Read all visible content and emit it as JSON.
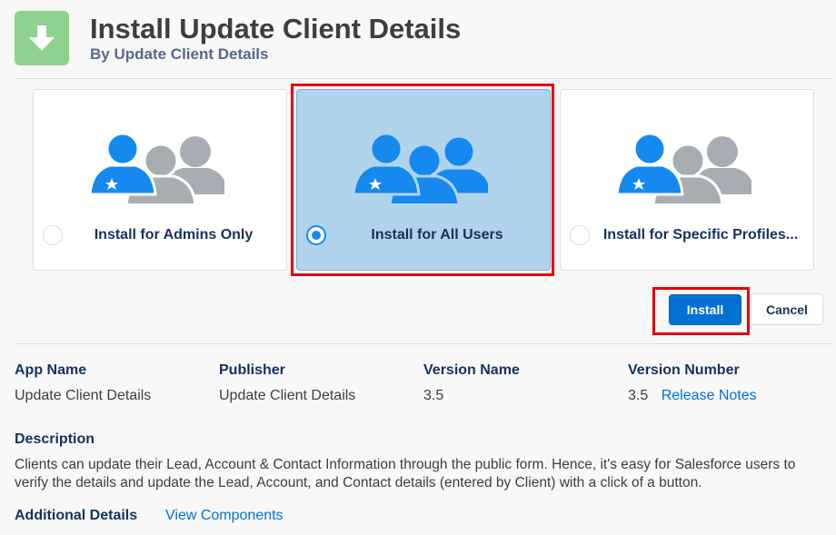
{
  "header": {
    "title": "Install Update Client Details",
    "subtitle": "By Update Client Details",
    "icon": "download-arrow-icon"
  },
  "colors": {
    "accent": "#0070d2",
    "selected_bg": "#b0d3ee",
    "highlight": "#e4000f",
    "admin_icon": "#1589ee",
    "user_icon_gray": "#a8adb3",
    "app_icon_bg": "#8fd18f"
  },
  "install_options": [
    {
      "label": "Install for Admins Only",
      "selected": false
    },
    {
      "label": "Install for All Users",
      "selected": true
    },
    {
      "label": "Install for Specific Profiles...",
      "selected": false
    }
  ],
  "actions": {
    "install_label": "Install",
    "cancel_label": "Cancel"
  },
  "details": {
    "app_name": {
      "label": "App Name",
      "value": "Update Client Details"
    },
    "publisher": {
      "label": "Publisher",
      "value": "Update Client Details"
    },
    "version_name": {
      "label": "Version Name",
      "value": "3.5"
    },
    "version_number": {
      "label": "Version Number",
      "value": "3.5",
      "link": "Release Notes"
    }
  },
  "description": {
    "label": "Description",
    "text": "Clients can update their Lead, Account & Contact Information through the public form. Hence, it's easy for Salesforce users to verify the details and update the Lead, Account, and Contact details (entered by Client) with a click of a button."
  },
  "additional_details": {
    "label": "Additional Details",
    "link": "View Components"
  }
}
